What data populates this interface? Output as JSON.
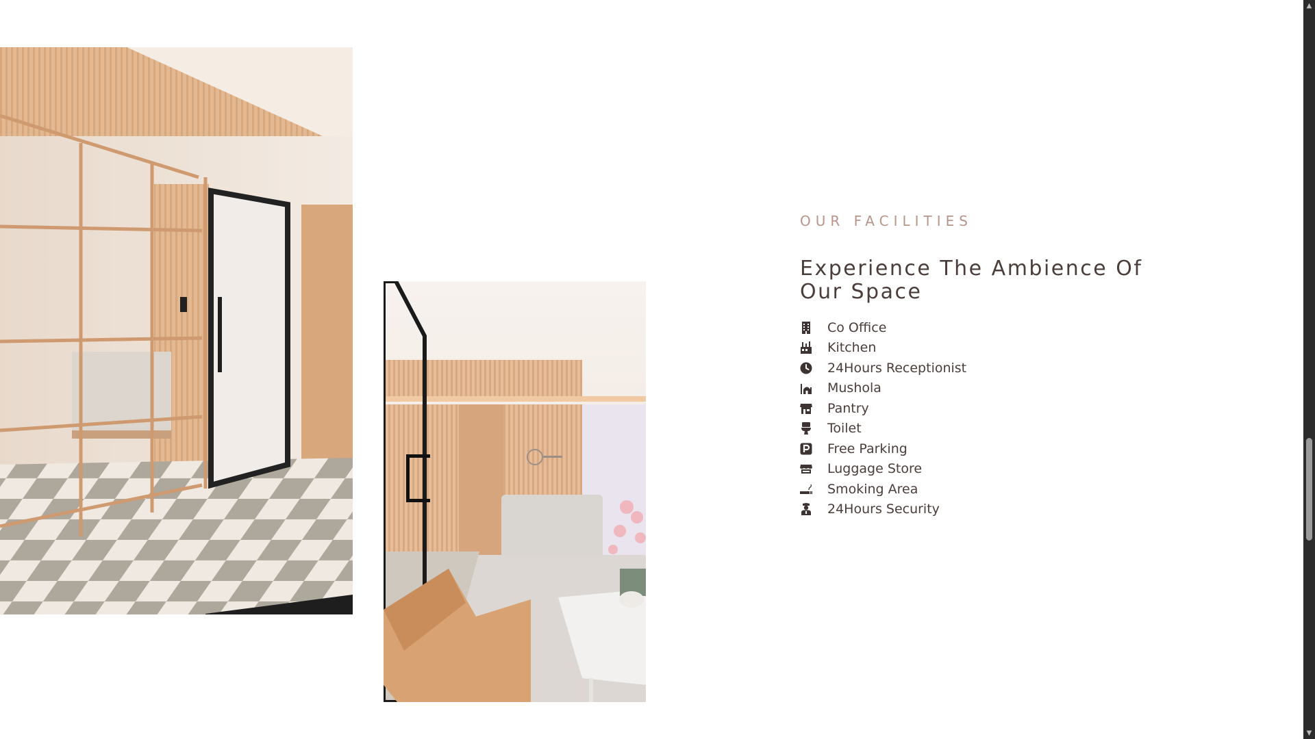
{
  "facilities": {
    "eyebrow": "OUR FACILITIES",
    "heading": "Experience The Ambience Of Our Space",
    "items": [
      {
        "label": "Co Office",
        "icon": "building-icon"
      },
      {
        "label": "Kitchen",
        "icon": "kitchen-icon"
      },
      {
        "label": "24Hours Receptionist",
        "icon": "clock-icon"
      },
      {
        "label": "Mushola",
        "icon": "mosque-icon"
      },
      {
        "label": "Pantry",
        "icon": "store-icon"
      },
      {
        "label": "Toilet",
        "icon": "toilet-icon"
      },
      {
        "label": "Free Parking",
        "icon": "parking-icon"
      },
      {
        "label": "Luggage Store",
        "icon": "storefront-icon"
      },
      {
        "label": "Smoking Area",
        "icon": "smoking-icon"
      },
      {
        "label": "24Hours Security",
        "icon": "security-guard-icon"
      }
    ]
  },
  "colors": {
    "eyebrow": "#b8958a",
    "heading": "#4a3d3a",
    "text": "#4a3d3a",
    "icon": "#3e3333",
    "scrollbar_track": "#2c2c2c",
    "scrollbar_thumb": "#9a9a9a"
  },
  "scrollbar": {
    "up_arrow": "▲",
    "down_arrow": "▼"
  }
}
